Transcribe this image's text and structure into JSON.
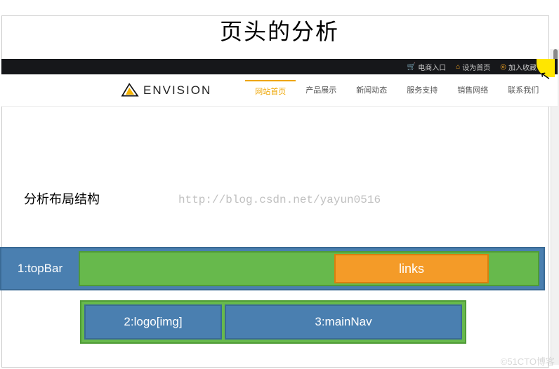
{
  "title": "页头的分析",
  "topbar": {
    "links": [
      {
        "icon": "🛒",
        "label": "电商入口"
      },
      {
        "icon": "⌂",
        "label": "设为首页"
      },
      {
        "icon": "◎",
        "label": "加入收藏"
      }
    ]
  },
  "logo": {
    "text": "ENVISION"
  },
  "nav": {
    "items": [
      {
        "label": "网站首页",
        "active": true
      },
      {
        "label": "产品展示"
      },
      {
        "label": "新闻动态"
      },
      {
        "label": "服务支持"
      },
      {
        "label": "销售网络"
      },
      {
        "label": "联系我们"
      }
    ]
  },
  "analysis": {
    "heading": "分析布局结构",
    "watermark": "http://blog.csdn.net/yayun0516"
  },
  "diagram": {
    "row1_label": "1:topBar",
    "links_label": "links",
    "logo_label": "2:logo[img]",
    "nav_label": "3:mainNav"
  },
  "footer_watermark": "©51CTO博客"
}
